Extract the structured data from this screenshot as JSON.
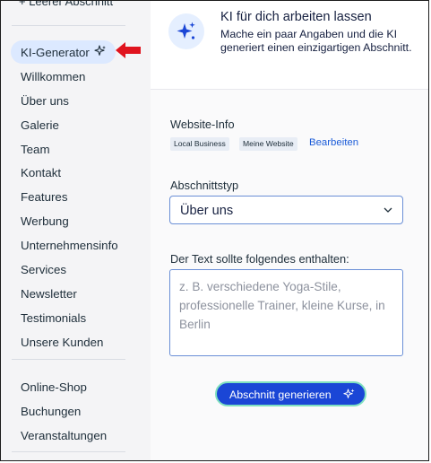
{
  "sidebar": {
    "top_link": "+ Leerer Abschnitt",
    "active_item": "KI-Generator",
    "items": [
      "Willkommen",
      "Über uns",
      "Galerie",
      "Team",
      "Kontakt",
      "Features",
      "Werbung",
      "Unternehmensinfo",
      "Services",
      "Newsletter",
      "Testimonials",
      "Unsere Kunden"
    ],
    "items2": [
      "Online-Shop",
      "Buchungen",
      "Veranstaltungen"
    ]
  },
  "banner": {
    "title": "KI für dich arbeiten lassen",
    "text": "Mache ein paar Angaben und die KI generiert einen einzigartigen Abschnitt."
  },
  "website_info": {
    "label": "Website-Info",
    "tags": [
      "Local Business",
      "Meine Website"
    ],
    "edit": "Bearbeiten"
  },
  "section_type": {
    "label": "Abschnittstyp",
    "value": "Über uns"
  },
  "content": {
    "label": "Der Text sollte folgendes enthalten:",
    "placeholder": "z. B. verschiedene Yoga-Stile, professionelle Trainer, kleine Kurse, in Berlin"
  },
  "generate_button": "Abschnitt generieren",
  "colors": {
    "accent": "#1a46d6",
    "active_pill": "#dce9ff",
    "arrow": "#e0141e",
    "link": "#1a5bd8",
    "button_border": "#7fe0c0"
  },
  "icons": [
    "sparkle-icon",
    "red-arrow-icon",
    "chevron-down-icon",
    "ai-sparkle-icon"
  ]
}
